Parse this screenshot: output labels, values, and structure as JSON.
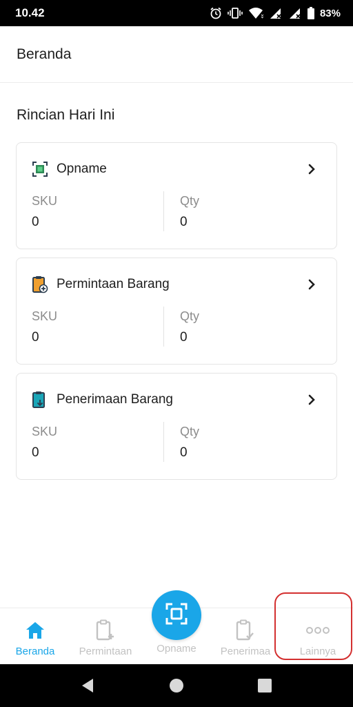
{
  "status_bar": {
    "time": "10.42",
    "battery": "83%",
    "icons": [
      "alarm-icon",
      "vibrate-icon",
      "wifi-icon",
      "signal-icon",
      "signal-icon-2",
      "battery-icon"
    ]
  },
  "header": {
    "title": "Beranda"
  },
  "section": {
    "title": "Rincian Hari Ini"
  },
  "cards": [
    {
      "name": "Opname",
      "icon": "opname-scan-icon",
      "sku_label": "SKU",
      "sku_value": "0",
      "qty_label": "Qty",
      "qty_value": "0"
    },
    {
      "name": "Permintaan Barang",
      "icon": "clipboard-add-icon",
      "sku_label": "SKU",
      "sku_value": "0",
      "qty_label": "Qty",
      "qty_value": "0"
    },
    {
      "name": "Penerimaan Barang",
      "icon": "clipboard-receive-icon",
      "sku_label": "SKU",
      "sku_value": "0",
      "qty_label": "Qty",
      "qty_value": "0"
    }
  ],
  "bottom_nav": {
    "items": [
      {
        "label": "Beranda",
        "icon": "home-icon",
        "active": true
      },
      {
        "label": "Permintaan",
        "icon": "clipboard-add-icon",
        "active": false
      },
      {
        "label": "Opname",
        "icon": "scan-icon",
        "active": false
      },
      {
        "label": "Penerimaa",
        "icon": "clipboard-check-icon",
        "active": false
      },
      {
        "label": "Lainnya",
        "icon": "more-icon",
        "active": false
      }
    ]
  },
  "colors": {
    "accent": "#1aa6e8",
    "inactive": "#c2c2c2",
    "highlight": "#d32f2f",
    "icon_green": "#2e8b57",
    "icon_orange": "#f0a030",
    "icon_teal": "#1aa6b8"
  }
}
